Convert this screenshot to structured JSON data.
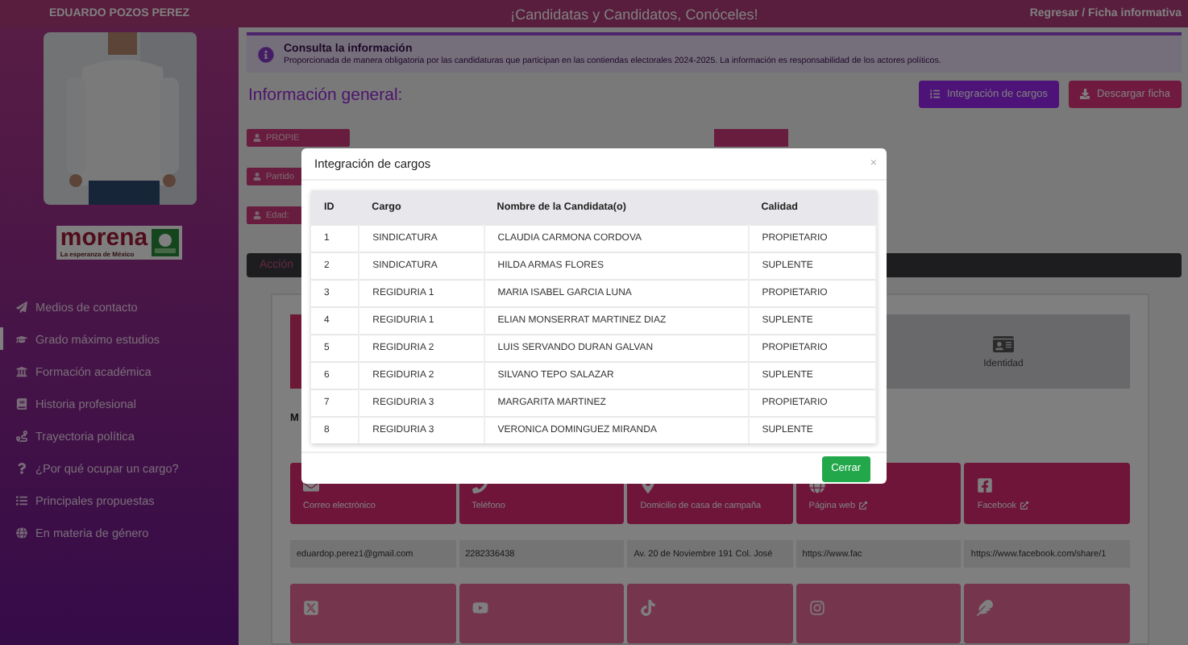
{
  "header": {
    "candidate": "EDUARDO POZOS PEREZ",
    "title": "¡Candidatas y Candidatos, Conóceles!",
    "links": "Regresar / Ficha informativa"
  },
  "sidebar": {
    "party": {
      "name": "morena",
      "slogan": "La esperanza de México"
    },
    "items": [
      {
        "label": "Medios de contacto",
        "kind": "send",
        "selected": false
      },
      {
        "label": "Grado máximo estudios",
        "kind": "cap",
        "selected": true
      },
      {
        "label": "Formación académica",
        "kind": "school",
        "selected": false
      },
      {
        "label": "Historia profesional",
        "kind": "book",
        "selected": false
      },
      {
        "label": "Trayectoria política",
        "kind": "route",
        "selected": false
      },
      {
        "label": "¿Por qué ocupar un cargo?",
        "kind": "question",
        "selected": false
      },
      {
        "label": "Principales propuestas",
        "kind": "list",
        "selected": false
      },
      {
        "label": "En materia de género",
        "kind": "globe",
        "selected": false
      }
    ]
  },
  "notice": {
    "title": "Consulta la información",
    "text": "Proporcionada de manera obligatoria por las candidaturas que participan en las contiendas electorales 2024-2025. La información es responsabilidad de los actores políticos."
  },
  "heading": "Información general:",
  "actions": [
    {
      "label": "Integración de cargos",
      "kind": "list"
    },
    {
      "label": "Descargar ficha",
      "kind": "download"
    }
  ],
  "chips": [
    "PROPIE",
    "Partido",
    "Edad:"
  ],
  "tab_bar": {
    "label": "Acción"
  },
  "identity_tile": "Identidad",
  "section_label": "M",
  "contact_tiles": [
    {
      "label": "Correo electrónico",
      "kind": "email",
      "external": false
    },
    {
      "label": "Teléfono",
      "kind": "phone",
      "external": false
    },
    {
      "label": "Domicilio de casa de campaña",
      "kind": "pin",
      "external": false
    },
    {
      "label": "Página web",
      "kind": "web",
      "external": true
    },
    {
      "label": "Facebook",
      "kind": "facebook",
      "external": true
    }
  ],
  "contact_values": [
    "eduardop.perez1@gmail.com",
    "2282336438",
    "Av. 20 de Noviembre 191 Col. José",
    "https://www.fac",
    "https://www.facebook.com/share/1"
  ],
  "social_tiles": [
    {
      "kind": "x"
    },
    {
      "kind": "youtube"
    },
    {
      "kind": "tiktok"
    },
    {
      "kind": "instagram"
    },
    {
      "kind": "feather"
    }
  ],
  "modal": {
    "title": "Integración de cargos",
    "close_glyph": "×",
    "columns": [
      "ID",
      "Cargo",
      "Nombre de la Candidata(o)",
      "Calidad"
    ],
    "rows": [
      [
        "1",
        "SINDICATURA",
        "CLAUDIA CARMONA CORDOVA",
        "PROPIETARIO"
      ],
      [
        "2",
        "SINDICATURA",
        "HILDA ARMAS FLORES",
        "SUPLENTE"
      ],
      [
        "3",
        "REGIDURIA 1",
        "MARIA ISABEL GARCIA LUNA",
        "PROPIETARIO"
      ],
      [
        "4",
        "REGIDURIA 1",
        "ELIAN MONSERRAT MARTINEZ DIAZ",
        "SUPLENTE"
      ],
      [
        "5",
        "REGIDURIA 2",
        "LUIS SERVANDO DURAN GALVAN",
        "PROPIETARIO"
      ],
      [
        "6",
        "REGIDURIA 2",
        "SILVANO TEPO SALAZAR",
        "SUPLENTE"
      ],
      [
        "7",
        "REGIDURIA 3",
        "MARGARITA MARTINEZ",
        "PROPIETARIO"
      ],
      [
        "8",
        "REGIDURIA 3",
        "VERONICA DOMINGUEZ MIRANDA",
        "SUPLENTE"
      ]
    ],
    "close_button": "Cerrar"
  }
}
